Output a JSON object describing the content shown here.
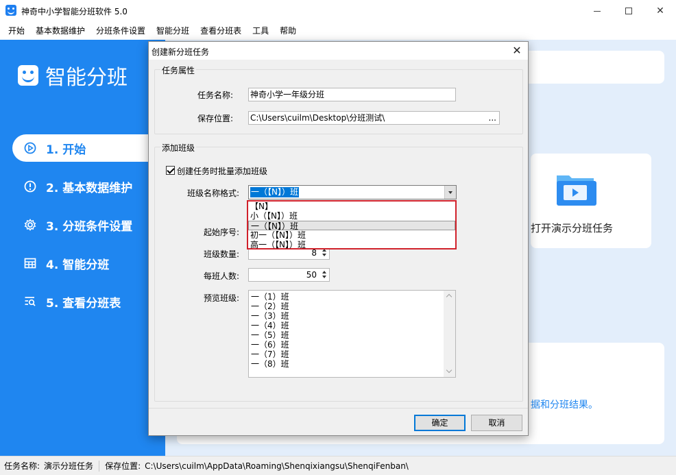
{
  "window": {
    "title": "神奇中小学智能分班软件 5.0",
    "min_symbol": "",
    "max_symbol": "",
    "close_symbol": "✕"
  },
  "menu": [
    "开始",
    "基本数据维护",
    "分班条件设置",
    "智能分班",
    "查看分班表",
    "工具",
    "帮助"
  ],
  "sidebar": {
    "logo_text": "智能分班",
    "items": [
      {
        "label": "1. 开始",
        "icon": "play-circle-icon",
        "active": true
      },
      {
        "label": "2. 基本数据维护",
        "icon": "info-circle-icon",
        "active": false
      },
      {
        "label": "3. 分班条件设置",
        "icon": "gear-icon",
        "active": false
      },
      {
        "label": "4. 智能分班",
        "icon": "table-grid-icon",
        "active": false
      },
      {
        "label": "5. 查看分班表",
        "icon": "search-list-icon",
        "active": false
      }
    ]
  },
  "content": {
    "demo_card_label": "打开演示分班任务",
    "bottom_text": "据和分班结果。",
    "accent_color": "#1f86f0"
  },
  "status": {
    "task_label": "任务名称:",
    "task_value": "演示分班任务",
    "path_label": "保存位置:",
    "path_value": "C:\\Users\\cuilm\\AppData\\Roaming\\Shenqixiangsu\\ShenqiFenban\\"
  },
  "dialog": {
    "title": "创建新分班任务",
    "close_symbol": "✕",
    "group1_label": "任务属性",
    "task_name_label": "任务名称:",
    "task_name_value": "神奇小学一年级分班",
    "save_path_label": "保存位置:",
    "save_path_value": "C:\\Users\\cuilm\\Desktop\\分班测试\\",
    "browse_symbol": "...",
    "group2_label": "添加班级",
    "batch_checkbox_label": "创建任务时批量添加班级",
    "batch_checked": true,
    "format_label": "班级名称格式:",
    "format_value": "一（【N】）班",
    "format_options": [
      {
        "label": "【N】",
        "selected": false
      },
      {
        "label": "小（【N】）班",
        "selected": false
      },
      {
        "label": "一（【N】）班",
        "selected": true
      },
      {
        "label": "初一（【N】）班",
        "selected": false
      },
      {
        "label": "高一（【N】）班",
        "selected": false
      }
    ],
    "start_label": "起始序号:",
    "count_label": "班级数量:",
    "count_value": "8",
    "per_class_label": "每班人数:",
    "per_class_value": "50",
    "preview_label": "预览班级:",
    "preview_items": [
      "一（1）班",
      "一（2）班",
      "一（3）班",
      "一（4）班",
      "一（5）班",
      "一（6）班",
      "一（7）班",
      "一（8）班"
    ],
    "ok_label": "确定",
    "cancel_label": "取消"
  }
}
